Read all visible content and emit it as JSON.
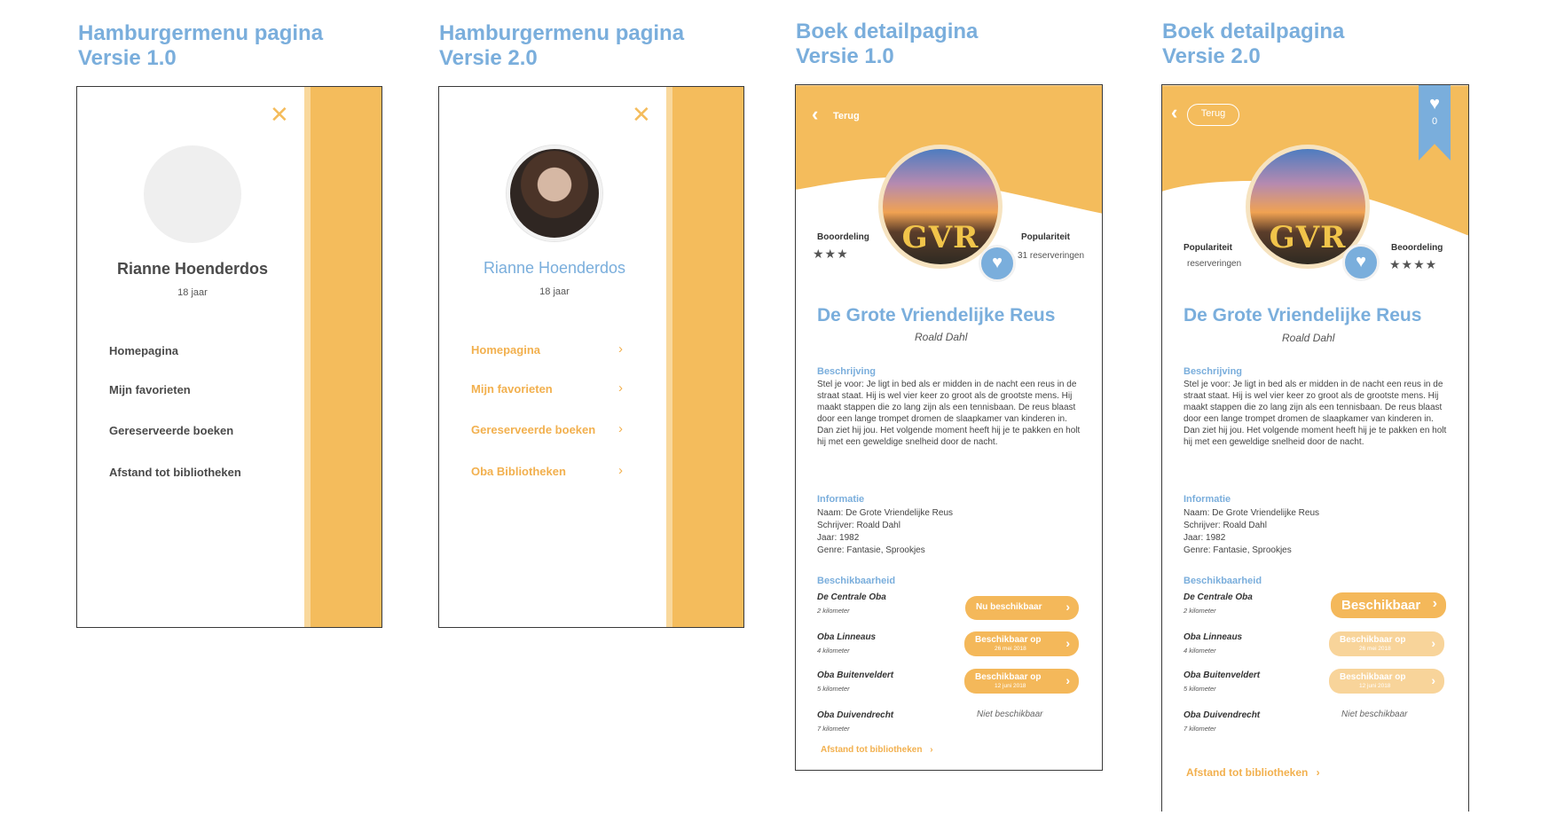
{
  "columns": [
    {
      "title_line1": "Hamburgermenu pagina",
      "title_line2": "Versie 1.0"
    },
    {
      "title_line1": "Hamburgermenu pagina",
      "title_line2": "Versie 2.0"
    },
    {
      "title_line1": "Boek detailpagina",
      "title_line2": "Versie 1.0"
    },
    {
      "title_line1": "Boek detailpagina",
      "title_line2": "Versie 2.0"
    }
  ],
  "menu_v1": {
    "close_icon": "close-icon",
    "user_name": "Rianne Hoenderdos",
    "user_age": "18 jaar",
    "items": [
      "Homepagina",
      "Mijn favorieten",
      "Gereserveerde boeken",
      "Afstand tot bibliotheken"
    ]
  },
  "menu_v2": {
    "close_icon": "close-icon",
    "user_name": "Rianne Hoenderdos",
    "user_age": "18 jaar",
    "items": [
      "Homepagina",
      "Mijn favorieten",
      "Gereserveerde boeken",
      "Oba Bibliotheken"
    ],
    "chevron": "›"
  },
  "book_v1": {
    "back_label": "Terug",
    "cover_text": "GVR",
    "rating_label": "Booordeling",
    "rating_stars": 3,
    "stars_text": "★★★",
    "popularity_label": "Populariteit",
    "popularity_value": "31 reserveringen",
    "title": "De Grote Vriendelijke Reus",
    "author": "Roald Dahl",
    "description_title": "Beschrijving",
    "description": "Stel je voor: Je ligt in bed als er midden in de nacht een reus in  de straat staat. Hij is wel vier keer zo groot als de grootste mens. Hij maakt stappen die zo lang zijn als een tennisbaan. De reus blaast door een lange trompet dromen de slaapkamer van kinderen in. Dan ziet hij jou. Het volgende moment heeft hij je te pakken en holt hij met een geweldige snelheid door de nacht.",
    "info_title": "Informatie",
    "info": [
      "Naam: De Grote Vriendelijke Reus",
      "Schrijver: Roald Dahl",
      "Jaar: 1982",
      "Genre: Fantasie, Sprookjes"
    ],
    "availability_title": "Beschikbaarheid",
    "libraries": [
      {
        "name": "De Centrale Oba",
        "distance": "2 kilometer",
        "button": "Nu beschikbaar",
        "date": ""
      },
      {
        "name": "Oba Linneaus",
        "distance": "4 kilometer",
        "button": "Beschikbaar op",
        "date": "26 mei 2018"
      },
      {
        "name": "Oba Buitenveldert",
        "distance": "5 kilometer",
        "button": "Beschikbaar op",
        "date": "12 juni 2018"
      },
      {
        "name": "Oba Duivendrecht",
        "distance": "7 kilometer",
        "status": "Niet beschikbaar"
      }
    ],
    "distance_link": "Afstand tot bibliotheken",
    "chevron": "›"
  },
  "book_v2": {
    "back_label": "Terug",
    "favorite_count": "0",
    "cover_text": "GVR",
    "popularity_label": "Populariteit",
    "popularity_value": "reserveringen",
    "rating_label": "Beoordeling",
    "rating_stars": 4,
    "stars_text": "★★★★",
    "title": "De Grote Vriendelijke Reus",
    "author": "Roald Dahl",
    "description_title": "Beschrijving",
    "description": "Stel je voor: Je ligt in bed als er midden in de nacht een reus in  de straat staat. Hij is wel vier keer zo groot als de grootste mens. Hij maakt stappen die zo lang zijn als een tennisbaan. De reus blaast door een lange trompet dromen de slaapkamer van kinderen in. Dan ziet hij jou. Het volgende moment heeft hij je te pakken en holt hij met een geweldige snelheid door de nacht.",
    "info_title": "Informatie",
    "info": [
      "Naam: De Grote Vriendelijke Reus",
      "Schrijver: Roald Dahl",
      "Jaar: 1982",
      "Genre: Fantasie, Sprookjes"
    ],
    "availability_title": "Beschikbaarheid",
    "libraries": [
      {
        "name": "De Centrale Oba",
        "distance": "2 kilometer",
        "button": "Beschikbaar",
        "date": ""
      },
      {
        "name": "Oba Linneaus",
        "distance": "4 kilometer",
        "button": "Beschikbaar op",
        "date": "26 mei 2018"
      },
      {
        "name": "Oba Buitenveldert",
        "distance": "5 kilometer",
        "button": "Beschikbaar op",
        "date": "12 juni 2018"
      },
      {
        "name": "Oba Duivendrecht",
        "distance": "7 kilometer",
        "status": "Niet beschikbaar"
      }
    ],
    "distance_link": "Afstand tot bibliotheken",
    "chevron": "›"
  },
  "colors": {
    "accent": "#f4bc5c",
    "blue": "#7aaedc"
  }
}
